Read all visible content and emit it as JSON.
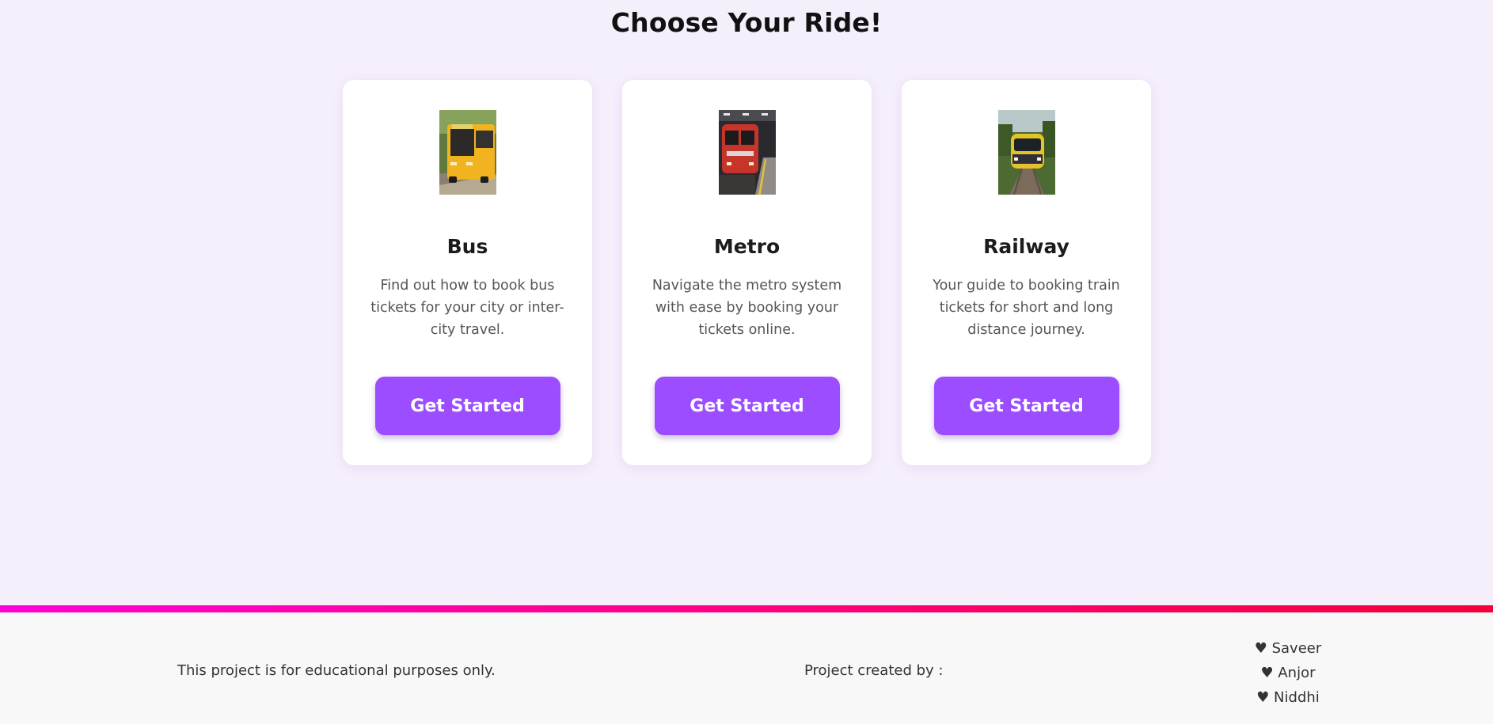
{
  "page": {
    "title": "Choose Your Ride!"
  },
  "cards": [
    {
      "id": "bus",
      "title": "Bus",
      "description": "Find out how to book bus tickets for your city or inter-city travel.",
      "button_label": "Get Started",
      "image_icon": "bus-photo"
    },
    {
      "id": "metro",
      "title": "Metro",
      "description": "Navigate the metro system with ease by booking your tickets online.",
      "button_label": "Get Started",
      "image_icon": "metro-photo"
    },
    {
      "id": "railway",
      "title": "Railway",
      "description": "Your guide to booking train tickets for short and long distance journey.",
      "button_label": "Get Started",
      "image_icon": "train-photo"
    }
  ],
  "footer": {
    "disclaimer": "This project is for educational purposes only.",
    "credit_label": "Project created by :",
    "creators": [
      "♥ Saveer",
      "♥ Anjor",
      "♥ Niddhi"
    ]
  },
  "colors": {
    "background": "#f5eefb",
    "card": "#ffffff",
    "accent": "#9b4dff",
    "divider_start": "#ff00d4",
    "divider_end": "#f5003a",
    "footer_bg": "#f8f8f8"
  }
}
